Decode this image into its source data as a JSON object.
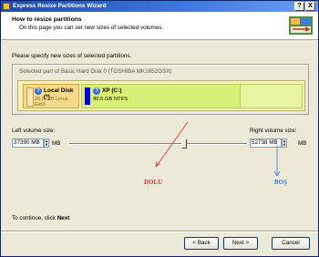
{
  "window": {
    "title": "Express Resize Partitions Wizard",
    "help_btn": "?",
    "close_btn": "X"
  },
  "header": {
    "title": "How to resize partitions",
    "subtitle": "On this page you can set new sizes of selected volumes."
  },
  "instruction": "Please specify new sizes of selected partitions.",
  "group": {
    "legend": "Selected part of Basic Hard Disk 0 (TOSHIBA MK1652GSX)",
    "partitions": [
      {
        "name": "Local Disk (*)",
        "info": "26.5 GB Linux Ext3"
      },
      {
        "name": "XP (C:)",
        "info": "90.5 GB NTFS"
      }
    ]
  },
  "sizes": {
    "left_label": "Left volume size:",
    "left_value": "37390 MB",
    "left_unit": "MB",
    "right_label": "Right volume size:",
    "right_value": "52738 MB",
    "right_unit": "MB",
    "slider_fraction": 0.64
  },
  "annotations": {
    "left": "DOLU",
    "right": "BOŞ",
    "left_color": "#e53030",
    "right_color": "#3b7fe0"
  },
  "footer": {
    "hint_prefix": "To continue, click",
    "hint_action": "Next",
    "back": "< Back",
    "next": "Next >",
    "cancel": "Cancel"
  }
}
